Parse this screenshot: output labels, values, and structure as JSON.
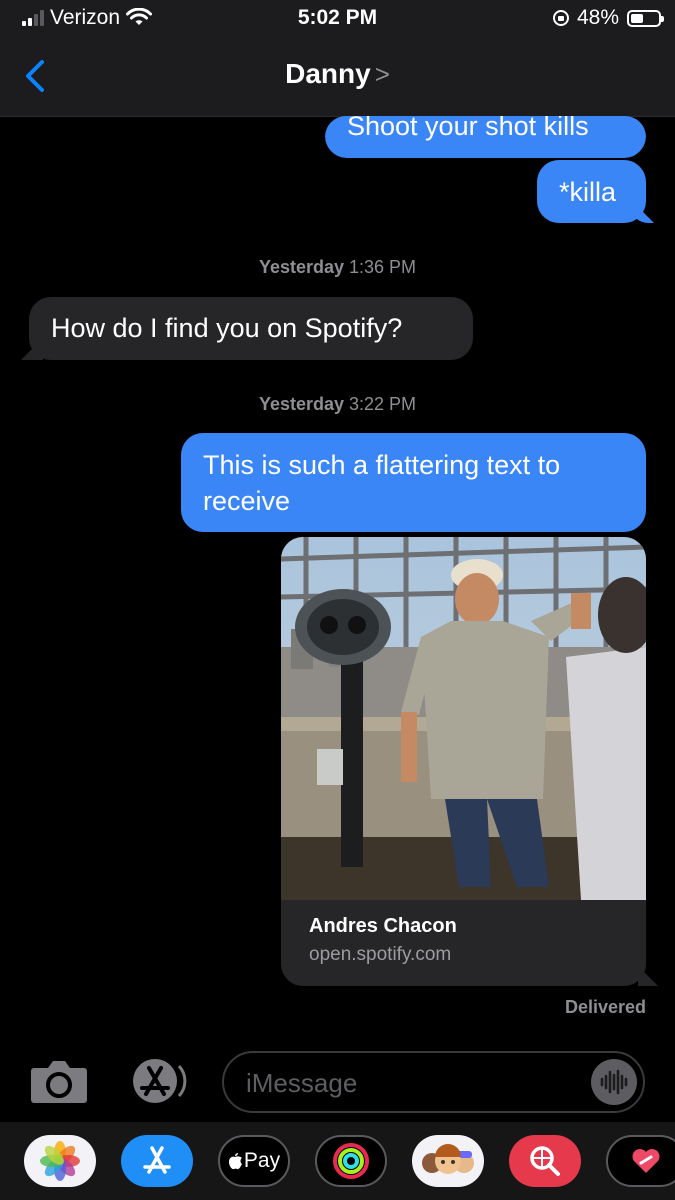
{
  "status_bar": {
    "carrier": "Verizon",
    "time": "5:02 PM",
    "battery": "48%",
    "battery_level": 0.48,
    "icons": [
      "signal-bars-icon",
      "wifi-icon",
      "orientation-lock-icon",
      "battery-icon"
    ]
  },
  "nav": {
    "back_icon": "chevron-left-icon",
    "contact_name": "Danny",
    "contact_chevron": ">"
  },
  "messages": [
    {
      "direction": "outgoing",
      "text": "Shoot your shot kills"
    },
    {
      "direction": "outgoing",
      "text": "*killa"
    },
    {
      "type": "timestamp",
      "day": "Yesterday",
      "time": "1:36 PM"
    },
    {
      "direction": "incoming",
      "text": "How do I find you on Spotify?"
    },
    {
      "type": "timestamp",
      "day": "Yesterday",
      "time": "3:22 PM"
    },
    {
      "direction": "outgoing",
      "text": "This is such a flattering text to receive"
    },
    {
      "direction": "outgoing",
      "type": "link_preview",
      "title": "Andres Chacon",
      "url": "open.spotify.com"
    }
  ],
  "delivery_status": "Delivered",
  "composer": {
    "placeholder": "iMessage",
    "icons": [
      "camera-icon",
      "app-store-icon",
      "audio-waveform-icon"
    ]
  },
  "app_drawer": {
    "apps": [
      "photos-icon",
      "app-store-icon",
      "apple-pay-icon",
      "activity-icon",
      "memoji-icon",
      "web-search-icon",
      "heart-sticker-icon"
    ],
    "apple_pay_label": "Pay"
  },
  "colors": {
    "outgoing_bubble": "#3a86f7",
    "incoming_bubble": "#262628",
    "timestamp": "#8e8e93",
    "accent": "#0a84ff"
  }
}
